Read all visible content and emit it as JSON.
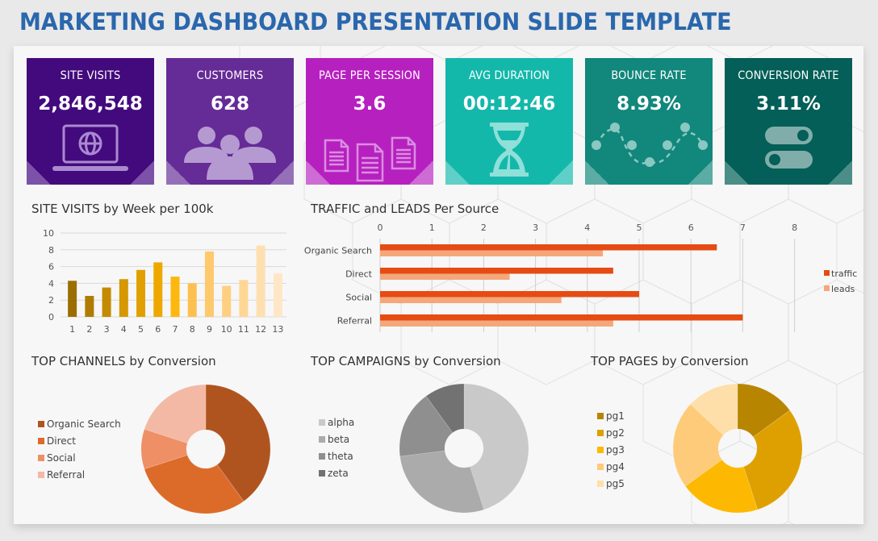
{
  "title": "MARKETING DASHBOARD PRESENTATION SLIDE TEMPLATE",
  "kpis": [
    {
      "label": "SITE VISITS",
      "value": "2,846,548",
      "icon": "laptop-globe-icon",
      "color": "#430a7d",
      "corner": "#7b52a8"
    },
    {
      "label": "CUSTOMERS",
      "value": "628",
      "icon": "people-group-icon",
      "color": "#652b96",
      "corner": "#9570b8"
    },
    {
      "label": "PAGE PER SESSION",
      "value": "3.6",
      "icon": "documents-icon",
      "color": "#b620bf",
      "corner": "#ce6bd4"
    },
    {
      "label": "AVG DURATION",
      "value": "00:12:46",
      "icon": "hourglass-icon",
      "color": "#14b8ab",
      "corner": "#5fd0c7"
    },
    {
      "label": "BOUNCE RATE",
      "value": "8.93%",
      "icon": "wave-dots-icon",
      "color": "#12877c",
      "corner": "#5aaca4"
    },
    {
      "label": "CONVERSION RATE",
      "value": "3.11%",
      "icon": "toggle-switches-icon",
      "color": "#035f57",
      "corner": "#4b8e88"
    }
  ],
  "chart_data": [
    {
      "type": "bar",
      "title": "SITE VISITS by Week per 100k",
      "categories": [
        "1",
        "2",
        "3",
        "4",
        "5",
        "6",
        "7",
        "8",
        "9",
        "10",
        "11",
        "12",
        "13"
      ],
      "values": [
        4.3,
        2.5,
        3.5,
        4.5,
        5.6,
        6.5,
        4.8,
        4.0,
        7.8,
        3.7,
        4.4,
        8.5,
        5.2
      ],
      "colors": [
        "#9c6e00",
        "#b07c00",
        "#c48a00",
        "#d69700",
        "#e1a000",
        "#eda800",
        "#fdb80f",
        "#fdc050",
        "#fec96c",
        "#fecf81",
        "#fed796",
        "#fee0b0",
        "#ffe7c6"
      ],
      "yticks": [
        0,
        2,
        4,
        6,
        8,
        10
      ],
      "ylim": [
        0,
        10
      ],
      "xlabel": "",
      "ylabel": "",
      "grid": true
    },
    {
      "type": "bar",
      "orientation": "horizontal",
      "title": "TRAFFIC and LEADS Per Source",
      "categories": [
        "Organic Search",
        "Direct",
        "Social",
        "Referral"
      ],
      "series": [
        {
          "name": "traffic",
          "values": [
            6.5,
            4.5,
            5.0,
            7.0
          ],
          "color": "#e64b14"
        },
        {
          "name": "leads",
          "values": [
            4.3,
            2.5,
            3.5,
            4.5
          ],
          "color": "#f4a77b"
        }
      ],
      "xticks": [
        0,
        1,
        2,
        3,
        4,
        5,
        6,
        7,
        8
      ],
      "xlim": [
        0,
        8
      ],
      "legend": "right",
      "grid": true
    },
    {
      "type": "pie",
      "title": "TOP CHANNELS by Conversion",
      "labels": [
        "Organic Search",
        "Direct",
        "Social",
        "Referral"
      ],
      "values": [
        40,
        30,
        10,
        20
      ],
      "colors": [
        "#b0541f",
        "#dc6b29",
        "#ee8f66",
        "#f3b9a4"
      ],
      "legend": "left"
    },
    {
      "type": "pie",
      "title": "TOP CAMPAIGNS by Conversion",
      "labels": [
        "alpha",
        "beta",
        "theta",
        "zeta"
      ],
      "values": [
        45,
        28,
        17,
        10
      ],
      "colors": [
        "#c9c9c9",
        "#ababab",
        "#8f8f8f",
        "#727272"
      ],
      "legend": "left"
    },
    {
      "type": "pie",
      "title": "TOP PAGES by Conversion",
      "labels": [
        "pg1",
        "pg2",
        "pg3",
        "pg4",
        "pg5"
      ],
      "values": [
        15,
        30,
        20,
        22,
        13
      ],
      "colors": [
        "#b88500",
        "#dea000",
        "#fdb902",
        "#fecb7a",
        "#fedfaa"
      ],
      "legend": "left"
    }
  ]
}
